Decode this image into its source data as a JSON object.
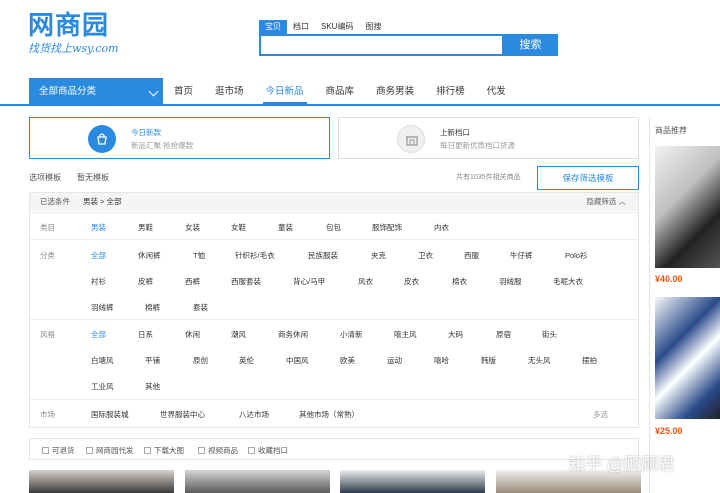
{
  "logo": {
    "main": "网商园",
    "sub": "找货找上wsy.com"
  },
  "search": {
    "tabs": [
      "宝贝",
      "档口",
      "SKU编码",
      "图搜"
    ],
    "active_tab": 0,
    "value": "",
    "button_label": "搜索"
  },
  "nav": {
    "category_button": "全部商品分类",
    "items": [
      "首页",
      "逛市场",
      "今日新品",
      "商品库",
      "商务男装",
      "排行榜",
      "代发"
    ],
    "active_index": 2
  },
  "cards": [
    {
      "title": "今日新款",
      "desc": "新品汇聚 抢抢爆款",
      "icon": "shopping-bag-icon"
    },
    {
      "title": "上新档口",
      "desc": "每日更新优质档口货源",
      "icon": "store-icon"
    }
  ],
  "options": {
    "template_link": "选项模板",
    "no_template": "暂无模板",
    "count_text": "共有1035件相关商品",
    "save_button": "保存筛选模板"
  },
  "filter": {
    "selected_label": "已选条件",
    "selected_value": "男装 > 全部",
    "hide_label": "隐藏筛选 ︿",
    "rows": [
      {
        "label": "类目",
        "options": [
          "男装",
          "男鞋",
          "女装",
          "女鞋",
          "童装",
          "包包",
          "服饰配饰",
          "内衣"
        ],
        "selected": 0
      },
      {
        "label": "分类",
        "options": [
          "全部",
          "休闲裤",
          "T恤",
          "针织衫/毛衣",
          "民族服装",
          "夹克",
          "卫衣",
          "西服",
          "牛仔裤",
          "Polo衫",
          "衬衫",
          "皮裤",
          "西裤",
          "西服套装",
          "背心/马甲",
          "风衣",
          "皮衣",
          "棉衣",
          "羽绒服",
          "毛呢大衣",
          "羽绒裤",
          "棉裤",
          "套装"
        ],
        "selected": 0
      },
      {
        "label": "风格",
        "options": [
          "全部",
          "日系",
          "休闲",
          "潮风",
          "商务休闲",
          "小清新",
          "嘻主风",
          "大码",
          "原宿",
          "街头",
          "白塘风",
          "平铺",
          "原创",
          "英伦",
          "中国风",
          "欧美",
          "运动",
          "嘻哈",
          "韩版",
          "无头风",
          "摆拍",
          "工业风",
          "其他"
        ],
        "selected": 0
      },
      {
        "label": "市场",
        "options": [
          "国际服装城",
          "世界服装中心",
          "八达市场",
          "其他市场（常熟）"
        ],
        "selected": -1,
        "more": "多选"
      }
    ]
  },
  "checks": [
    "可退货",
    "网商园代发",
    "下载大图",
    "视频商品",
    "收藏档口"
  ],
  "rail": {
    "title": "商品推荐",
    "prices": [
      "¥40.00",
      "¥25.00"
    ]
  },
  "watermark": "知乎 @顾顾君",
  "colors": {
    "accent": "#2a8ae0",
    "price": "#e8530e"
  }
}
